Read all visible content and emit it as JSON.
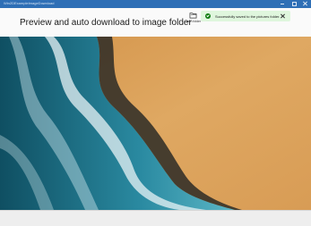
{
  "window": {
    "title": "Win2DExampleImageDownload"
  },
  "header": {
    "title": "Preview and auto download to image folder",
    "open_folder_label": "Open folder",
    "open_folder_icon": "folder-open-icon"
  },
  "notification": {
    "message": "Successfully saved to the pictures folder.",
    "status_icon": "checkmark-circle-icon",
    "status_color": "#0f7b0f",
    "background": "#dff6dd"
  },
  "preview": {
    "description_icon": "aerial-beach-photo"
  },
  "colors": {
    "titlebar": "#2f6fb6",
    "sand": "#d9a05a",
    "ocean": "#1f6f8a"
  }
}
